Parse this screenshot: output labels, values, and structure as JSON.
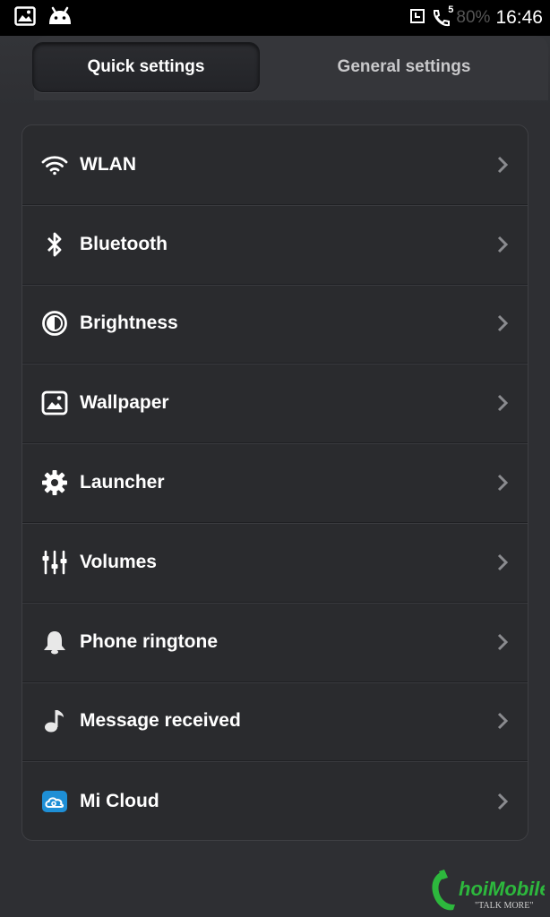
{
  "status_bar": {
    "left_icons": [
      "image-icon",
      "android-icon"
    ],
    "right_icons": [
      "alarm-icon",
      "call-icon"
    ],
    "call_badge": "5",
    "battery": "80%",
    "time": "16:46"
  },
  "tabs": [
    {
      "label": "Quick settings",
      "active": true
    },
    {
      "label": "General settings",
      "active": false
    }
  ],
  "items": [
    {
      "label": "WLAN",
      "icon": "wifi-icon"
    },
    {
      "label": "Bluetooth",
      "icon": "bluetooth-icon"
    },
    {
      "label": "Brightness",
      "icon": "brightness-icon"
    },
    {
      "label": "Wallpaper",
      "icon": "wallpaper-icon"
    },
    {
      "label": "Launcher",
      "icon": "gear-icon"
    },
    {
      "label": "Volumes",
      "icon": "sliders-icon"
    },
    {
      "label": "Phone ringtone",
      "icon": "bell-icon"
    },
    {
      "label": "Message received",
      "icon": "music-note-icon"
    },
    {
      "label": "Mi Cloud",
      "icon": "cloud-icon"
    }
  ],
  "colors": {
    "background": "#2e2f33",
    "list_bg": "#2a2b2e",
    "text": "#ffffff",
    "inactive_tab_text": "#c9c9cb",
    "chevron": "#8a8b8f",
    "mi_cloud_blue": "#1e8fd6",
    "watermark_green": "#2db83d"
  },
  "watermark": {
    "brand": "hoiMobile",
    "tagline": "\"TALK MORE\""
  }
}
